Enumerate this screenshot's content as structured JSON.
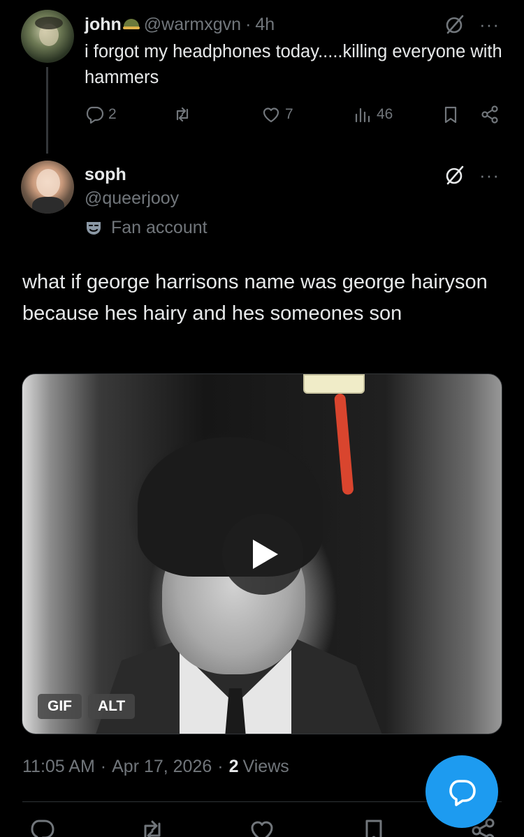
{
  "reply": {
    "name": "john",
    "handle": "@warmxgvn",
    "dot": "·",
    "time": "4h",
    "text": "i forgot my headphones today.....killing everyone with hammers",
    "replies": "2",
    "retweets": "",
    "likes": "7",
    "views": "46",
    "more": "···"
  },
  "tweet": {
    "name": "soph",
    "handle": "@queerjooy",
    "label": "Fan account",
    "text": "what if george harrisons name was george hairyson because hes hairy and hes someones son",
    "more": "···",
    "media": {
      "type": "gif",
      "badge_gif": "GIF",
      "badge_alt": "ALT"
    },
    "time": "11:05 AM",
    "dot": "·",
    "date": "Apr 17, 2026",
    "views_count": "2",
    "views_label": "Views"
  },
  "colors": {
    "background": "#000000",
    "text": "#e7e9ea",
    "secondary": "#71767b",
    "accent": "#1d9bf0"
  },
  "icons": {
    "grok": "grok-icon",
    "more": "more-icon",
    "reply": "reply-icon",
    "retweet": "retweet-icon",
    "like": "like-icon",
    "views": "views-icon",
    "bookmark": "bookmark-icon",
    "share": "share-icon",
    "fan": "mask-icon",
    "compose": "compose-reply-icon"
  }
}
